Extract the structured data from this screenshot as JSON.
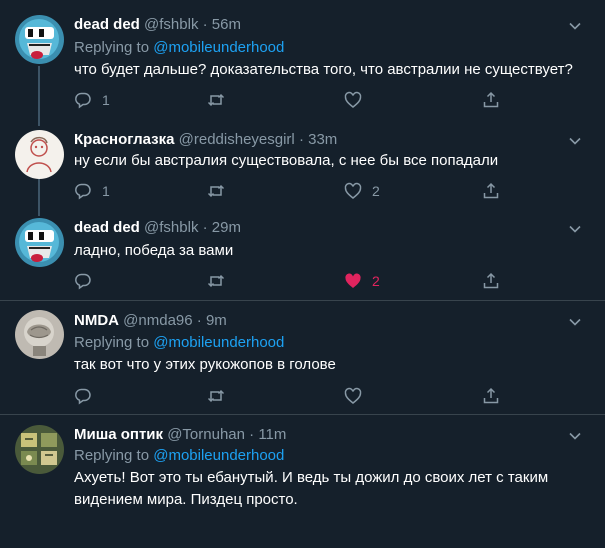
{
  "tweets": [
    {
      "name": "dead ded",
      "handle": "@fshblk",
      "time": "56m",
      "replying_prefix": "Replying to",
      "replying_to": "@mobileunderhood",
      "text": "что будет дальше? доказательства того, что австралии не существует?",
      "reply_count": "1",
      "retweet_count": "",
      "like_count": "",
      "liked": false
    },
    {
      "name": "Красноглазка",
      "handle": "@reddisheyesgirl",
      "time": "33m",
      "text": "ну если бы австралия существовала, с нее бы все попадали",
      "reply_count": "1",
      "retweet_count": "",
      "like_count": "2",
      "liked": false
    },
    {
      "name": "dead ded",
      "handle": "@fshblk",
      "time": "29m",
      "text": "ладно, победа за вами",
      "reply_count": "",
      "retweet_count": "",
      "like_count": "2",
      "liked": true
    },
    {
      "name": "NMDA",
      "handle": "@nmda96",
      "time": "9m",
      "replying_prefix": "Replying to",
      "replying_to": "@mobileunderhood",
      "text": "так вот что у этих рукожопов в голове",
      "reply_count": "",
      "retweet_count": "",
      "like_count": "",
      "liked": false
    },
    {
      "name": "Миша оптик",
      "handle": "@Tornuhan",
      "time": "11m",
      "replying_prefix": "Replying to",
      "replying_to": "@mobileunderhood",
      "text": "Ахуеть! Вот это ты ебанутый. И ведь ты дожил до своих лет с таким видением мира. Пиздец просто.",
      "reply_count": "",
      "retweet_count": "",
      "like_count": "",
      "liked": false
    }
  ],
  "separator": "·",
  "colors": {
    "background": "#15202b",
    "accent": "#1da1f2",
    "muted": "#8899a6",
    "like": "#e0245e",
    "divider": "#38444d"
  },
  "icons": [
    "reply-icon",
    "retweet-icon",
    "like-icon",
    "share-icon",
    "chevron-down-icon"
  ]
}
